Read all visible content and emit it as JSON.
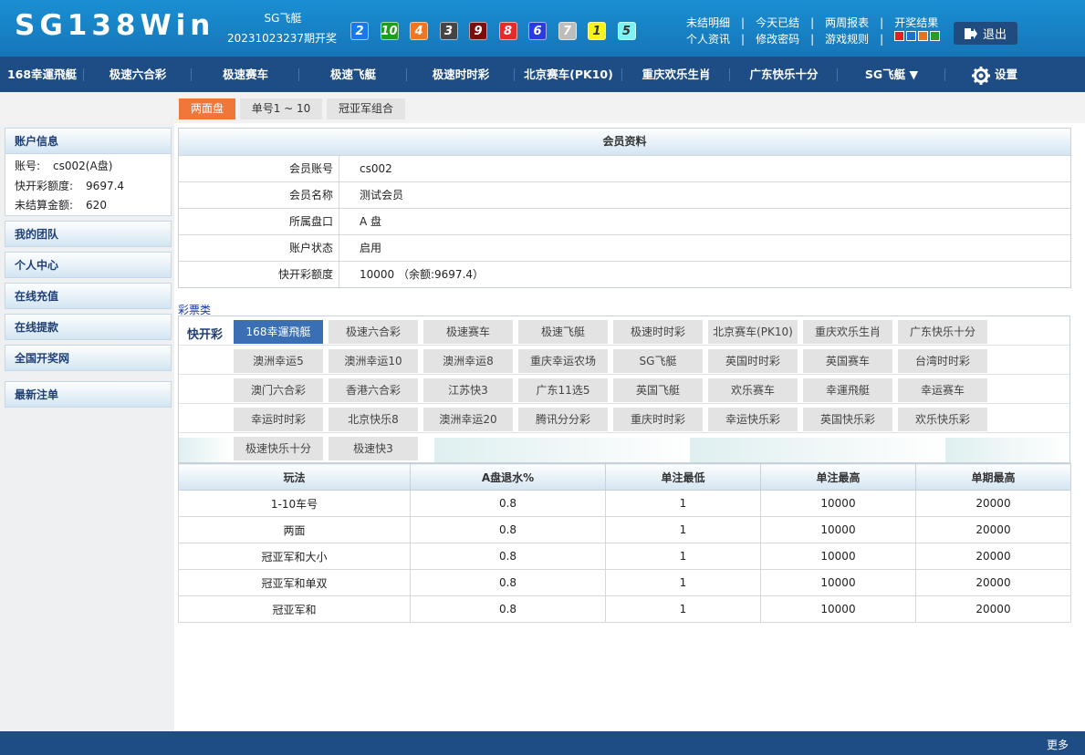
{
  "header": {
    "logo": "SG138Win",
    "lottery": "SG飞艇",
    "period": "20231023237期开奖",
    "balls": [
      {
        "n": "2",
        "bg": "#1979ea",
        "fg": "#ffffff"
      },
      {
        "n": "10",
        "bg": "#1e9e1e",
        "fg": "#ffffff"
      },
      {
        "n": "4",
        "bg": "#f07622",
        "fg": "#ffffff"
      },
      {
        "n": "3",
        "bg": "#454545",
        "fg": "#ffffff"
      },
      {
        "n": "9",
        "bg": "#7a0e0e",
        "fg": "#ffffff"
      },
      {
        "n": "8",
        "bg": "#e82929",
        "fg": "#ffffff"
      },
      {
        "n": "6",
        "bg": "#2a3be0",
        "fg": "#ffffff"
      },
      {
        "n": "7",
        "bg": "#bdbdbd",
        "fg": "#ffffff"
      },
      {
        "n": "1",
        "bg": "#f6f31c",
        "fg": "#333333"
      },
      {
        "n": "5",
        "bg": "#7df4f4",
        "fg": "#333333"
      }
    ],
    "links_row1": [
      "未结明细",
      "今天已结",
      "两周报表",
      "开奖结果"
    ],
    "links_row2": [
      "个人资讯",
      "修改密码",
      "游戏规则"
    ],
    "swatch_colors": [
      "#e02020",
      "#1e6fd0",
      "#f07020",
      "#2a9a2a"
    ],
    "logout": "退出"
  },
  "nav": {
    "items": [
      "168幸運飛艇",
      "极速六合彩",
      "极速赛车",
      "极速飞艇",
      "极速时时彩",
      "北京赛车(PK10)",
      "重庆欢乐生肖",
      "广东快乐十分",
      "SG飞艇 ▼"
    ],
    "settings": "设置"
  },
  "subtabs": [
    "两面盘",
    "单号1 ~ 10",
    "冠亚军组合"
  ],
  "sidebar": {
    "account_title": "账户信息",
    "account_label": "账号:",
    "account_value": "cs002(A盘)",
    "credit_label": "快开彩额度:",
    "credit_value": "9697.4",
    "unsettled_label": "未结算金额:",
    "unsettled_value": "620",
    "menu": [
      "我的团队",
      "个人中心",
      "在线充值",
      "在线提款",
      "全国开奖网",
      "最新注单"
    ]
  },
  "member": {
    "title": "会员资料",
    "rows": [
      {
        "k": "会员账号",
        "v": "cs002"
      },
      {
        "k": "会员名称",
        "v": "测试会员"
      },
      {
        "k": "所属盘口",
        "v": "A 盘"
      },
      {
        "k": "账户状态",
        "v": "启用"
      },
      {
        "k": "快开彩额度",
        "v": "10000 （余额:9697.4）"
      }
    ]
  },
  "lottery_section": {
    "label": "彩票类",
    "group": "快开彩",
    "items": [
      "168幸運飛艇",
      "极速六合彩",
      "极速赛车",
      "极速飞艇",
      "极速时时彩",
      "北京赛车(PK10)",
      "重庆欢乐生肖",
      "广东快乐十分",
      "澳洲幸运5",
      "澳洲幸运10",
      "澳洲幸运8",
      "重庆幸运农场",
      "SG飞艇",
      "英国时时彩",
      "英国赛车",
      "台湾时时彩",
      "澳门六合彩",
      "香港六合彩",
      "江苏快3",
      "广东11选5",
      "英国飞艇",
      "欢乐赛车",
      "幸運飛艇",
      "幸运赛车",
      "幸运时时彩",
      "北京快乐8",
      "澳洲幸运20",
      "腾讯分分彩",
      "重庆时时彩",
      "幸运快乐彩",
      "英国快乐彩",
      "欢乐快乐彩",
      "极速快乐十分",
      "极速快3"
    ]
  },
  "limits": {
    "headers": [
      "玩法",
      "A盘退水%",
      "单注最低",
      "单注最高",
      "单期最高"
    ],
    "rows": [
      [
        "1-10车号",
        "0.8",
        "1",
        "10000",
        "20000"
      ],
      [
        "两面",
        "0.8",
        "1",
        "10000",
        "20000"
      ],
      [
        "冠亚军和大小",
        "0.8",
        "1",
        "10000",
        "20000"
      ],
      [
        "冠亚军和单双",
        "0.8",
        "1",
        "10000",
        "20000"
      ],
      [
        "冠亚军和",
        "0.8",
        "1",
        "10000",
        "20000"
      ]
    ]
  },
  "footer": {
    "more": "更多"
  }
}
